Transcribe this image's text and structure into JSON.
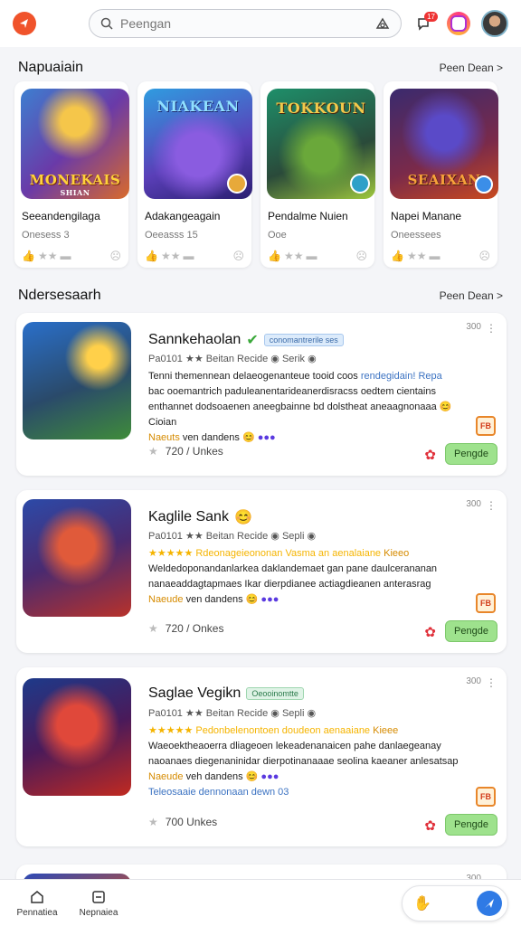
{
  "search": {
    "placeholder": "Peengan",
    "value": ""
  },
  "header": {
    "badge_count": "17"
  },
  "section1": {
    "title": "Napuaiain",
    "see_all": "Peen Dean >"
  },
  "featured": [
    {
      "art_title": "MONEKAIS",
      "art_sub": "SHIAN",
      "name": "Seeandengilaga",
      "sub": "Onesess 3",
      "colors": [
        "#3d7fd0",
        "#d96a2a"
      ]
    },
    {
      "art_title": "NIAKEAN",
      "art_sub": "",
      "name": "Adakangeagain",
      "sub": "Oeeasss 15",
      "colors": [
        "#5a3fb8",
        "#2f9ce0"
      ]
    },
    {
      "art_title": "TOKKOUN",
      "art_sub": "",
      "name": "Pendalme Nuien",
      "sub": "Ooe",
      "colors": [
        "#1e8f6a",
        "#9ec83c"
      ]
    },
    {
      "art_title": "SEAIXAN",
      "art_sub": "",
      "name": "Napei Manane",
      "sub": "Oneessees",
      "colors": [
        "#3a2a6e",
        "#c94a1e"
      ]
    }
  ],
  "section2": {
    "title": "Ndersesaarh",
    "see_all": "Peen Dean >"
  },
  "list": [
    {
      "title": "Sannkehaolan",
      "tag": "conomantrerile ses",
      "size": "300",
      "dev": "Pa0101 ★★ Beitan Recide ◉ Serik ◉",
      "desc1": "Tenni themennean delaeogenanteue tooid coos",
      "desc1b": "rendegidain! Repa",
      "desc2": "bac ooemantrich paduleanentarideanerdisracss oedtem cientains",
      "desc3": "enthannet dodsoaenen aneegbainne bd dolstheat aneaagnonaaa",
      "desc3b": "Cioian",
      "desc4_gold": "Naeuts",
      "desc4": "ven dandens",
      "rating": "720 / Unkes",
      "button": "Pengde",
      "chip": "FB",
      "art_colors": [
        "#2a6fc9",
        "#3f8c3a"
      ]
    },
    {
      "title": "Kaglile Sank",
      "tag": "",
      "size": "300",
      "dev": "Pa0101 ★★ Beitan Recide ◉ Sepli ◉",
      "desc1": "★★★★★ Rdeonageieononan Vasma an aenalaiane",
      "desc1b": "Kieeo",
      "desc2": "Weldedoponandanlarkea daklandemaet gan pane daulcerananan",
      "desc3": "nanaeaddagtapmaes Ikar dierpdianee actiagdieanen anterasrag",
      "desc3b": "",
      "desc4_gold": "Naeude",
      "desc4": "ven dandens",
      "rating": "720 / Onkes",
      "button": "Pengde",
      "chip": "FB",
      "art_colors": [
        "#2c4aa8",
        "#b8322a"
      ]
    },
    {
      "title": "Saglae Vegikn",
      "tag": "Oeooinomtte",
      "size": "300",
      "dev": "Pa0101 ★★ Beitan Recide ◉ Sepli ◉",
      "desc1": "★★★★★ Pedonbelenontoen doudeon aenaaiane",
      "desc1b": "Kieee",
      "desc2": "Waeoektheaoerra dliageoen lekeadenanaicen pahe danlaegeanay",
      "desc3": "naoanaes diegenaninidar dierpotinanaaae seolina kaeaner anlesatsap",
      "desc3b": "",
      "desc4_gold": "Naeude",
      "desc4": "veh dandens",
      "desc5": "Teleosaaie dennonaan dewn 03",
      "rating": "700 Unkes",
      "button": "Pengde",
      "chip": "FB",
      "art_colors": [
        "#1d3a8a",
        "#c12a20"
      ]
    }
  ],
  "peek": {
    "size": "300"
  },
  "bottom_nav": [
    {
      "label": "Pennatiea"
    },
    {
      "label": "Nepnaiea"
    }
  ]
}
